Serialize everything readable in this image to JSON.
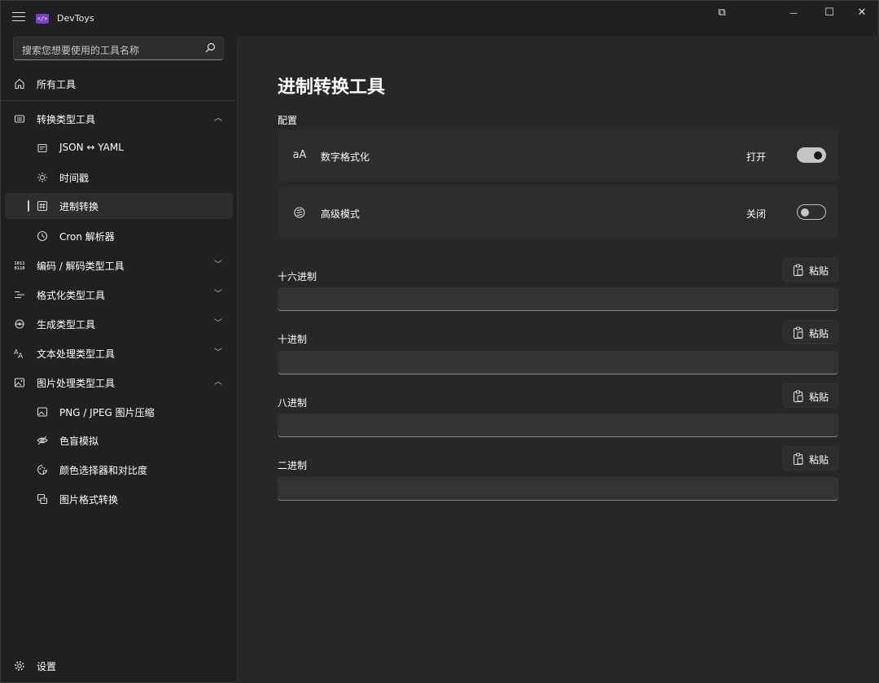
{
  "app": {
    "title": "DevToys",
    "logo_text": "</>"
  },
  "window_controls": {
    "snap": "⧉",
    "minimize": "—",
    "maximize": "☐",
    "close": "✕"
  },
  "search": {
    "placeholder": "搜索您想要使用的工具名称"
  },
  "sidebar": {
    "all_tools": "所有工具",
    "groups": [
      {
        "label": "转换类型工具",
        "icon": "converter-icon",
        "expanded": true,
        "items": [
          {
            "label": "JSON ↔ YAML",
            "icon": "json-yaml-icon"
          },
          {
            "label": "时间戳",
            "icon": "timestamp-icon"
          },
          {
            "label": "进制转换",
            "icon": "number-base-icon",
            "selected": true
          },
          {
            "label": "Cron 解析器",
            "icon": "clock-icon"
          }
        ]
      },
      {
        "label": "编码 / 解码类型工具",
        "icon": "binary-icon",
        "expanded": false
      },
      {
        "label": "格式化类型工具",
        "icon": "formatter-icon",
        "expanded": false
      },
      {
        "label": "生成类型工具",
        "icon": "generator-icon",
        "expanded": false
      },
      {
        "label": "文本处理类型工具",
        "icon": "text-icon",
        "expanded": false
      },
      {
        "label": "图片处理类型工具",
        "icon": "image-icon",
        "expanded": true,
        "items": [
          {
            "label": "PNG / JPEG 图片压缩",
            "icon": "image-compress-icon"
          },
          {
            "label": "色盲模拟",
            "icon": "eye-icon"
          },
          {
            "label": "颜色选择器和对比度",
            "icon": "color-picker-icon"
          },
          {
            "label": "图片格式转换",
            "icon": "image-convert-icon"
          }
        ]
      }
    ],
    "settings": "设置"
  },
  "main": {
    "title": "进制转换工具",
    "config_label": "配置",
    "settings": [
      {
        "icon": "aA",
        "label": "数字格式化",
        "state_text": "打开",
        "on": true
      },
      {
        "icon": "advanced-icon",
        "label": "高级模式",
        "state_text": "关闭",
        "on": false
      }
    ],
    "fields": [
      {
        "label": "十六进制",
        "paste": "粘贴",
        "value": ""
      },
      {
        "label": "十进制",
        "paste": "粘贴",
        "value": ""
      },
      {
        "label": "八进制",
        "paste": "粘贴",
        "value": ""
      },
      {
        "label": "二进制",
        "paste": "粘贴",
        "value": ""
      }
    ]
  }
}
